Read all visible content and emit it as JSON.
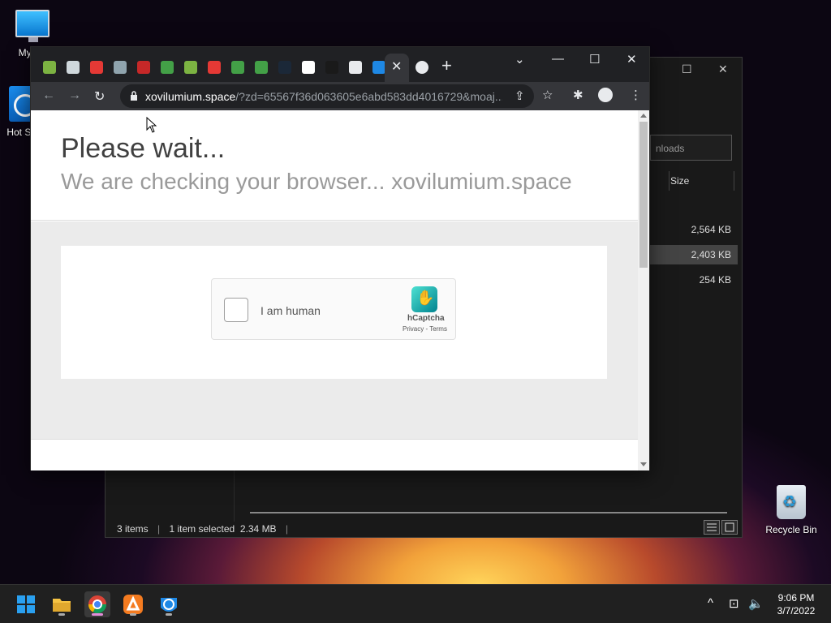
{
  "desktop": {
    "icons": [
      {
        "label": "My Co",
        "icon": "computer-icon"
      },
      {
        "label": "Hot Shi",
        "icon": "hotspot-shield-icon"
      },
      {
        "label": "Recycle Bin",
        "icon": "recycle-bin-icon"
      }
    ]
  },
  "explorer": {
    "search_placeholder": "nloads",
    "column_size": "Size",
    "rows": [
      {
        "size": "2,564 KB",
        "selected": false
      },
      {
        "size": "2,403 KB",
        "selected": true
      },
      {
        "size": "254 KB",
        "selected": false
      }
    ],
    "status": {
      "items": "3 items",
      "selected": "1 item selected  2.34 MB"
    }
  },
  "browser": {
    "tabs": [
      {
        "icon": "bluestacks-icon",
        "color": "#7cb342"
      },
      {
        "icon": "globe-icon",
        "color": "#cfd8dc"
      },
      {
        "icon": "colorful-ball-icon",
        "color": "#e53935"
      },
      {
        "icon": "shield-icon",
        "color": "#90a4ae"
      },
      {
        "icon": "opera-icon",
        "color": "#c62828"
      },
      {
        "icon": "download-icon",
        "color": "#43a047"
      },
      {
        "icon": "bluestacks-icon",
        "color": "#7cb342"
      },
      {
        "icon": "colorful-ball-icon",
        "color": "#e53935"
      },
      {
        "icon": "download-icon",
        "color": "#43a047"
      },
      {
        "icon": "download-icon",
        "color": "#43a047"
      },
      {
        "icon": "steam-icon",
        "color": "#1b2838"
      },
      {
        "icon": "google-icon",
        "color": "#ffffff"
      },
      {
        "icon": "mask-icon",
        "color": "#1a1a1a"
      },
      {
        "icon": "edit-icon",
        "color": "#e8eaed"
      },
      {
        "icon": "fish-icon",
        "color": "#1e88e5"
      }
    ],
    "active_tab_icon": "close-icon",
    "extra_tab_icon": "cloud-icon",
    "url_host": "xovilumium.space",
    "url_rest": "/?zd=65567f36d063605e6abd583dd4016729&moaj...",
    "page": {
      "heading": "Please wait...",
      "subheading": "We are checking your browser... xovilumium.space",
      "captcha": {
        "label": "I am human",
        "brand": "hCaptcha",
        "links": "Privacy - Terms"
      }
    }
  },
  "taskbar": {
    "apps": [
      "start-icon",
      "file-explorer-icon",
      "chrome-icon",
      "avast-icon",
      "browser-icon"
    ],
    "time": "9:06 PM",
    "date": "3/7/2022"
  }
}
